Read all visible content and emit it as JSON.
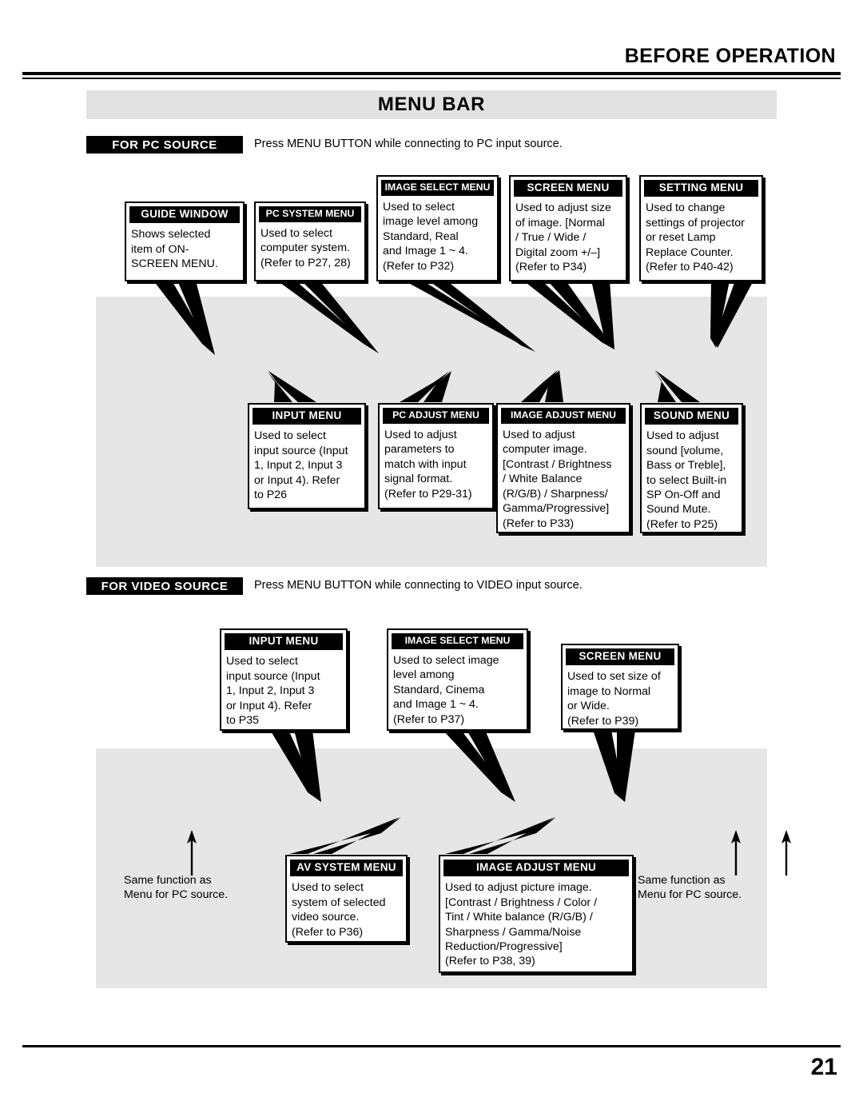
{
  "header": {
    "running_head": "BEFORE OPERATION",
    "section_title": "MENU BAR"
  },
  "pc_source": {
    "tag": "FOR PC SOURCE",
    "note": "Press MENU BUTTON while connecting to PC input source.",
    "top_row": [
      {
        "title": "GUIDE WINDOW",
        "body": "Shows selected\nitem of ON-\nSCREEN MENU."
      },
      {
        "title": "PC SYSTEM MENU",
        "body": "Used to select\ncomputer system.\n(Refer to P27, 28)"
      },
      {
        "title": "IMAGE SELECT MENU",
        "body": "Used to select\nimage level among\nStandard, Real\nand Image 1 ~ 4.\n(Refer to P32)"
      },
      {
        "title": "SCREEN MENU",
        "body": "Used to adjust size\nof image.  [Normal\n/ True / Wide /\nDigital zoom +/–]\n(Refer to P34)"
      },
      {
        "title": "SETTING MENU",
        "body": "Used to change\nsettings of projector\nor reset Lamp\nReplace Counter.\n(Refer to P40-42)"
      }
    ],
    "bottom_row": [
      {
        "title": "INPUT MENU",
        "body": "Used to select\ninput source (Input\n1, Input 2, Input 3\nor Input 4). Refer\nto P26"
      },
      {
        "title": "PC ADJUST MENU",
        "body": "Used to adjust\nparameters to\nmatch with input\nsignal format.\n(Refer to P29-31)"
      },
      {
        "title": "IMAGE ADJUST MENU",
        "body": "Used to adjust\ncomputer image.\n[Contrast / Brightness\n/ White Balance\n(R/G/B) / Sharpness/\nGamma/Progressive]\n(Refer to P33)"
      },
      {
        "title": "SOUND MENU",
        "body": "Used to adjust\nsound [volume,\nBass or Treble],\nto select Built-in\nSP On-Off and\nSound Mute.\n(Refer to P25)"
      }
    ]
  },
  "video_source": {
    "tag": "FOR VIDEO SOURCE",
    "note": "Press MENU BUTTON while connecting to VIDEO input source.",
    "top_row": [
      {
        "title": "INPUT MENU",
        "body": "Used to select\ninput source (Input\n1, Input 2, Input 3\nor Input 4). Refer\nto P35"
      },
      {
        "title": "IMAGE SELECT MENU",
        "body": "Used to select image\nlevel among\nStandard, Cinema\nand Image 1 ~ 4.\n(Refer to P37)"
      },
      {
        "title": "SCREEN MENU",
        "body": "Used to set size of\nimage to Normal\nor Wide.\n(Refer to P39)"
      }
    ],
    "bottom_row": [
      {
        "title": "AV SYSTEM MENU",
        "body": "Used to select\nsystem of selected\nvideo source.\n(Refer to P36)"
      },
      {
        "title": "IMAGE ADJUST MENU",
        "body": "Used to adjust picture image.\n[Contrast / Brightness / Color /\nTint / White balance (R/G/B) /\nSharpness / Gamma/Noise\nReduction/Progressive]\n(Refer to P38, 39)"
      }
    ],
    "notes": [
      "Same function as\nMenu for PC source.",
      "Same function as\nMenu for PC source."
    ]
  },
  "footer": {
    "page_number": "21"
  },
  "colors": {
    "banner_grey": "#e2e2e2",
    "panel_grey": "#e6e6e6",
    "ink": "#000000",
    "paper": "#ffffff"
  }
}
